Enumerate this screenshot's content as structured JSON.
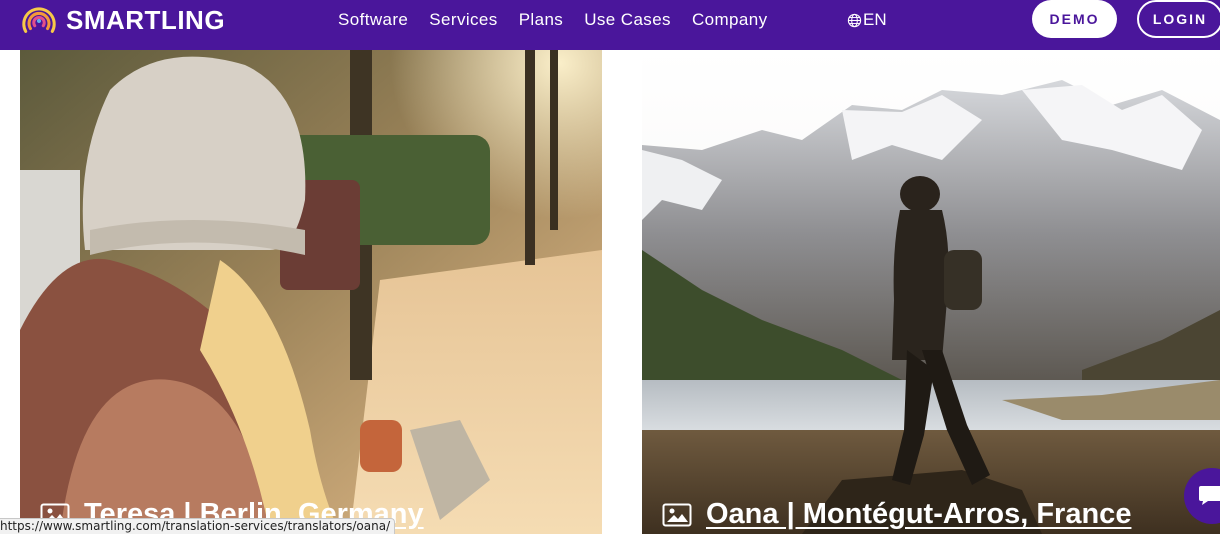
{
  "nav": {
    "brand": "SMARTLING",
    "links": [
      "Software",
      "Services",
      "Plans",
      "Use Cases",
      "Company"
    ],
    "language": "EN",
    "demo_label": "DEMO",
    "login_label": "LOGIN"
  },
  "cards": [
    {
      "caption": "Teresa | Berlin, Germany"
    },
    {
      "caption": "Oana | Montégut-Arros, France"
    }
  ],
  "status_url": "https://www.smartling.com/translation-services/translators/oana/",
  "colors": {
    "brand": "#4a169b",
    "white": "#ffffff"
  }
}
